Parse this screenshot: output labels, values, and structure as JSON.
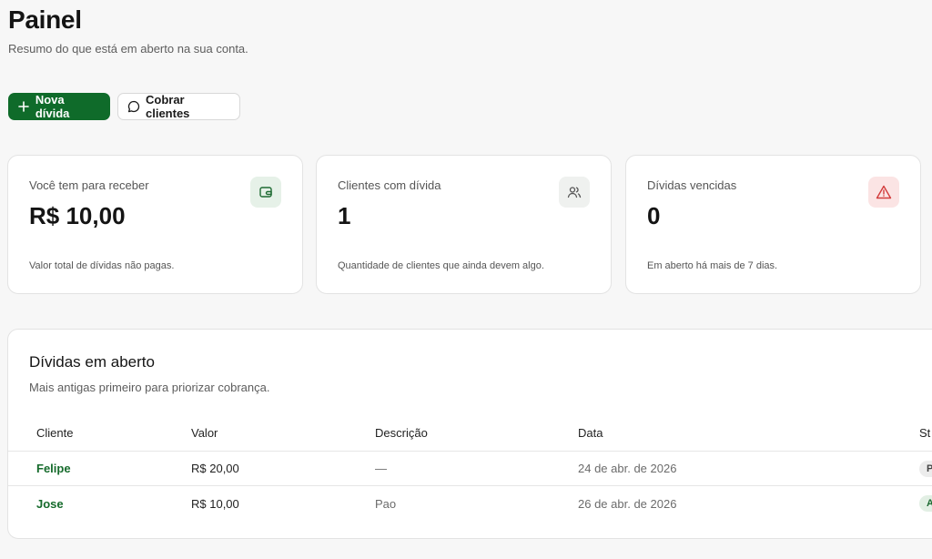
{
  "header": {
    "title": "Painel",
    "subtitle": "Resumo do que está em aberto na sua conta."
  },
  "actions": {
    "new_debt_label": "Nova dívida",
    "charge_clients_label": "Cobrar clientes"
  },
  "cards": [
    {
      "label": "Você tem para receber",
      "value": "R$ 10,00",
      "note": "Valor total de dívidas não pagas.",
      "icon": "wallet-icon"
    },
    {
      "label": "Clientes com dívida",
      "value": "1",
      "note": "Quantidade de clientes que ainda devem algo.",
      "icon": "users-icon"
    },
    {
      "label": "Dívidas vencidas",
      "value": "0",
      "note": "Em aberto há mais de 7 dias.",
      "icon": "alert-triangle-icon"
    }
  ],
  "table": {
    "title": "Dívidas em aberto",
    "subtitle": "Mais antigas primeiro para priorizar cobrança.",
    "columns": [
      "Cliente",
      "Valor",
      "Descrição",
      "Data",
      "St"
    ],
    "rows": [
      {
        "client": "Felipe",
        "value": "R$ 20,00",
        "description": "—",
        "date": "24 de abr. de 2026",
        "status": "P"
      },
      {
        "client": "Jose",
        "value": "R$ 10,00",
        "description": "Pao",
        "date": "26 de abr. de 2026",
        "status": "A"
      }
    ]
  },
  "colors": {
    "primary": "#0f6b2a",
    "link": "#166b2c",
    "danger": "#d23b3b"
  }
}
